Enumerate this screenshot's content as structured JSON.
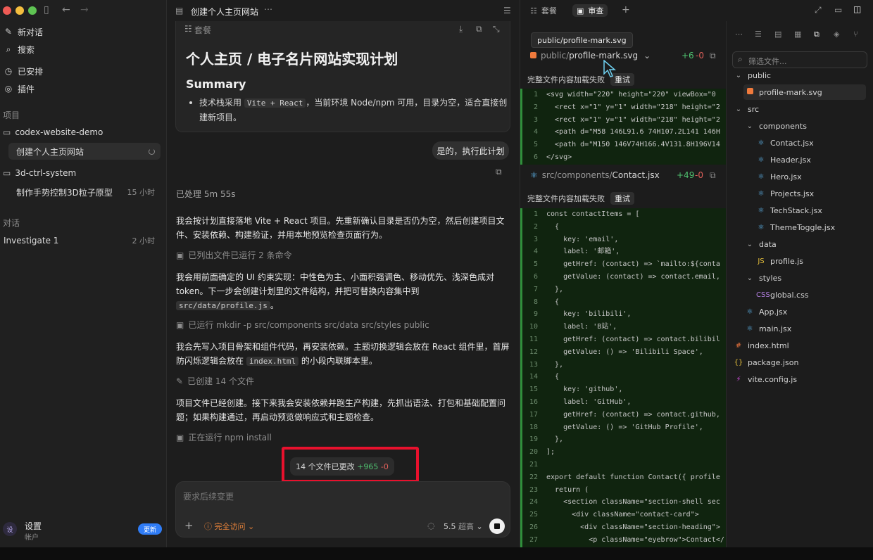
{
  "sidebar": {
    "new_chat": "新对话",
    "search": "搜索",
    "scheduled": "已安排",
    "plugins": "插件",
    "projects_label": "项目",
    "project1": "codex-website-demo",
    "project1_task": "创建个人主页网站",
    "project2": "3d-ctrl-system",
    "project2_task": "制作手势控制3D粒子原型",
    "project2_task_time": "15 小时",
    "conversations_label": "对话",
    "conv1": "Investigate 1",
    "conv1_time": "2 小时",
    "settings": "设置",
    "account": "帐户",
    "avatar": "设",
    "update": "更新"
  },
  "chat": {
    "title": "创建个人主页网站",
    "plan_label": "套餐",
    "plan_title": "个人主页 / 电子名片网站实现计划",
    "summary_heading": "Summary",
    "summary_item_pre": "技术栈采用",
    "summary_item_code": "Vite + React",
    "summary_item_post": "，当前环境 Node/npm 可用，目录为空，适合直接创建新项目。",
    "user_reply": "是的，执行此计划",
    "processed": "已处理 5m 55s",
    "msg1": "我会按计划直接落地 Vite + React 项目。先重新确认目录是否仍为空，然后创建项目文件、安装依赖、构建验证，并用本地预览检查页面行为。",
    "tool1": "已列出文件已运行 2 条命令",
    "msg2_pre": "我会用前面确定的 UI 约束实现：中性色为主、小面积强调色、移动优先、浅深色成对 token。下一步会创建计划里的文件结构，并把可替换内容集中到",
    "msg2_code": "src/data/profile.js",
    "msg2_post": "。",
    "tool2": "已运行 mkdir -p src/components src/data src/styles public",
    "msg3_pre": "我会先写入项目骨架和组件代码，再安装依赖。主题切换逻辑会放在 React 组件里，首屏防闪烁逻辑会放在",
    "msg3_code": "index.html",
    "msg3_post": "的小段内联脚本里。",
    "tool3": "已创建 14 个文件",
    "msg4": "项目文件已经创建。接下来我会安装依赖并跑生产构建，先抓出语法、打包和基础配置问题；如果构建通过，再启动预览做响应式和主题检查。",
    "tool4": "正在运行 npm install",
    "changes_label": "14 个文件已更改",
    "changes_add": "+965",
    "changes_del": "-0",
    "composer_placeholder": "要求后续变更",
    "access": "完全访问",
    "model": "5.5",
    "model_effort": "超高"
  },
  "review": {
    "tab_plan": "套餐",
    "tab_review": "审查",
    "tooltip": "public/profile-mark.svg",
    "file1_dir": "public/",
    "file1_name": "profile-mark.svg",
    "file1_add": "+6",
    "file1_del": "-0",
    "load_fail": "完整文件内容加载失败",
    "retry": "重试",
    "file2_dir": "src/components/",
    "file2_name": "Contact.jsx",
    "file2_add": "+49",
    "file2_del": "-0",
    "file1_lines": [
      "<svg width=\"220\" height=\"220\" viewBox=\"0",
      "  <rect x=\"1\" y=\"1\" width=\"218\" height=\"2",
      "  <rect x=\"1\" y=\"1\" width=\"218\" height=\"2",
      "  <path d=\"M58 146L91.6 74H107.2L141 146H",
      "  <path d=\"M150 146V74H166.4V131.8H196V14",
      "</svg>"
    ],
    "file2_lines": [
      "const contactItems = [",
      "  {",
      "    key: 'email',",
      "    label: '邮箱',",
      "    getHref: (contact) => `mailto:${conta",
      "    getValue: (contact) => contact.email,",
      "  },",
      "  {",
      "    key: 'bilibili',",
      "    label: 'B站',",
      "    getHref: (contact) => contact.bilibil",
      "    getValue: () => 'Bilibili Space',",
      "  },",
      "  {",
      "    key: 'github',",
      "    label: 'GitHub',",
      "    getHref: (contact) => contact.github,",
      "    getValue: () => 'GitHub Profile',",
      "  },",
      "];",
      "",
      "export default function Contact({ profile",
      "  return (",
      "    <section className=\"section-shell sec",
      "      <div className=\"contact-card\">",
      "        <div className=\"section-heading\">",
      "          <p className=\"eyebrow\">Contact</"
    ]
  },
  "tree": {
    "filter_placeholder": "筛选文件...",
    "nodes": [
      {
        "label": "public",
        "kind": "folder",
        "depth": 0
      },
      {
        "label": "profile-mark.svg",
        "kind": "svg",
        "depth": 1,
        "selected": true
      },
      {
        "label": "src",
        "kind": "folder",
        "depth": 0
      },
      {
        "label": "components",
        "kind": "folder",
        "depth": 1
      },
      {
        "label": "Contact.jsx",
        "kind": "react",
        "depth": 2
      },
      {
        "label": "Header.jsx",
        "kind": "react",
        "depth": 2
      },
      {
        "label": "Hero.jsx",
        "kind": "react",
        "depth": 2
      },
      {
        "label": "Projects.jsx",
        "kind": "react",
        "depth": 2
      },
      {
        "label": "TechStack.jsx",
        "kind": "react",
        "depth": 2
      },
      {
        "label": "ThemeToggle.jsx",
        "kind": "react",
        "depth": 2
      },
      {
        "label": "data",
        "kind": "folder",
        "depth": 1
      },
      {
        "label": "profile.js",
        "kind": "js",
        "depth": 2
      },
      {
        "label": "styles",
        "kind": "folder",
        "depth": 1
      },
      {
        "label": "global.css",
        "kind": "css",
        "depth": 2
      },
      {
        "label": "App.jsx",
        "kind": "react",
        "depth": 1
      },
      {
        "label": "main.jsx",
        "kind": "react",
        "depth": 1
      },
      {
        "label": "index.html",
        "kind": "html",
        "depth": 0
      },
      {
        "label": "package.json",
        "kind": "json",
        "depth": 0
      },
      {
        "label": "vite.config.js",
        "kind": "vite",
        "depth": 0
      }
    ]
  }
}
